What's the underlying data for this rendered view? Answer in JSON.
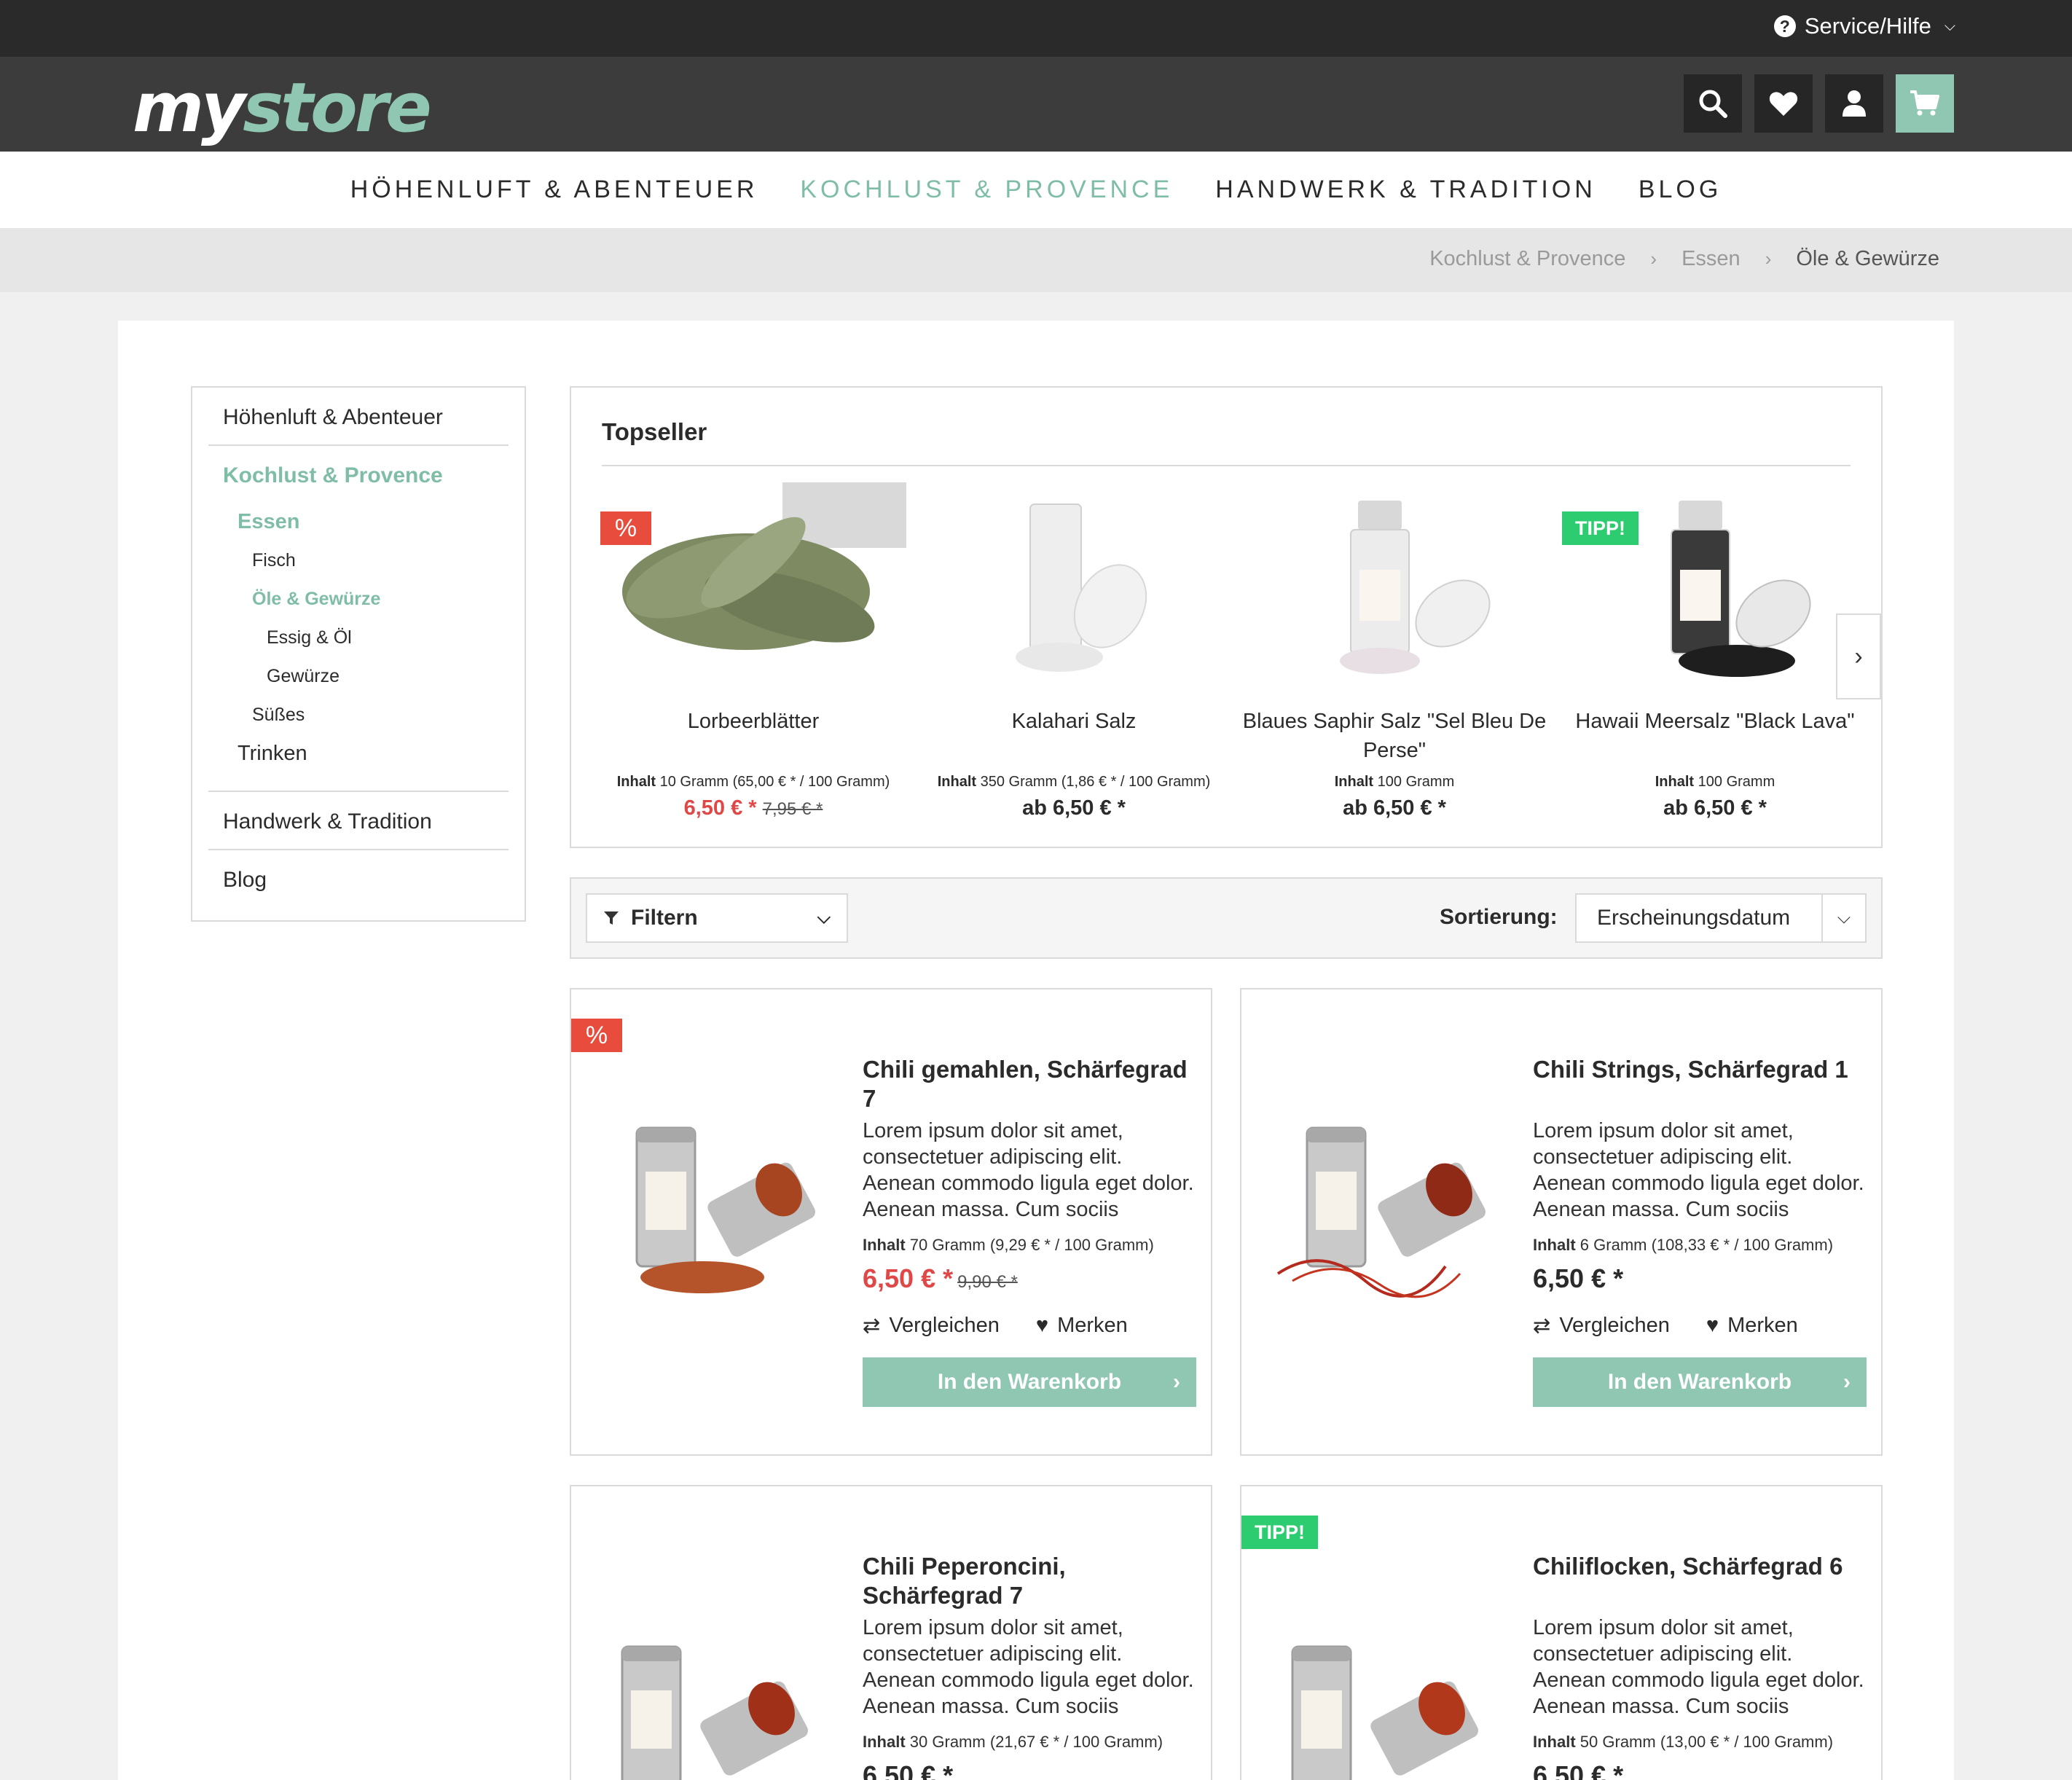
{
  "service": {
    "label": "Service/Hilfe"
  },
  "logo": {
    "part1": "my",
    "part2": "store"
  },
  "colors": {
    "accent": "#8fc7b3",
    "sale": "#e74c3c",
    "tipp": "#2ecc71",
    "header": "#3c3c3c",
    "topbar": "#2a2a2a"
  },
  "header_icons": [
    "search-icon",
    "heart-icon",
    "user-icon",
    "cart-icon"
  ],
  "mainnav": [
    "HÖHENLUFT & ABENTEUER",
    "KOCHLUST & PROVENCE",
    "HANDWERK & TRADITION",
    "BLOG"
  ],
  "breadcrumb": [
    "Kochlust & Provence",
    "Essen",
    "Öle & Gewürze"
  ],
  "sidebar": {
    "l1_a": "Höhenluft & Abenteuer",
    "l1_b": "Kochlust & Provence",
    "essen": "Essen",
    "fisch": "Fisch",
    "oele": "Öle & Gewürze",
    "essig": "Essig & Öl",
    "gewuerze": "Gewürze",
    "suesses": "Süßes",
    "trinken": "Trinken",
    "l1_c": "Handwerk & Tradition",
    "l1_d": "Blog"
  },
  "topseller": {
    "title": "Topseller",
    "items": [
      {
        "name": "Lorbeerblätter",
        "content_label": "Inhalt",
        "content": "10 Gramm (65,00 € * / 100 Gramm)",
        "price": "6,50 € *",
        "old_price": "7,95 € *",
        "badge": "%"
      },
      {
        "name": "Kalahari Salz",
        "content_label": "Inhalt",
        "content": "350 Gramm (1,86 € * / 100 Gramm)",
        "price": "ab 6,50 € *"
      },
      {
        "name": "Blaues Saphir Salz \"Sel Bleu De Perse\"",
        "content_label": "Inhalt",
        "content": "100 Gramm",
        "price": "ab 6,50 € *"
      },
      {
        "name": "Hawaii Meersalz \"Black Lava\"",
        "content_label": "Inhalt",
        "content": "100 Gramm",
        "price": "ab 6,50 € *",
        "badge": "TIPP!"
      }
    ]
  },
  "filter": {
    "label": "Filtern",
    "sort_label": "Sortierung:",
    "sort_value": "Erscheinungsdatum"
  },
  "products": [
    {
      "title": "Chili gemahlen, Schärfegrad 7",
      "desc": "Lorem ipsum dolor sit amet, consectetuer adipiscing elit. Aenean commodo ligula eget dolor. Aenean massa. Cum sociis",
      "content_label": "Inhalt",
      "content": "70 Gramm (9,29 € * / 100 Gramm)",
      "price": "6,50 € *",
      "old_price": "9,90 € *",
      "badge": "%",
      "compare": "Vergleichen",
      "remember": "Merken",
      "cart": "In den Warenkorb"
    },
    {
      "title": "Chili Strings, Schärfegrad 1",
      "desc": "Lorem ipsum dolor sit amet, consectetuer adipiscing elit. Aenean commodo ligula eget dolor. Aenean massa. Cum sociis",
      "content_label": "Inhalt",
      "content": "6 Gramm (108,33 € * / 100 Gramm)",
      "price": "6,50 € *",
      "compare": "Vergleichen",
      "remember": "Merken",
      "cart": "In den Warenkorb"
    },
    {
      "title": "Chili Peperoncini, Schärfegrad 7",
      "desc": "Lorem ipsum dolor sit amet, consectetuer adipiscing elit. Aenean commodo ligula eget dolor. Aenean massa. Cum sociis",
      "content_label": "Inhalt",
      "content": "30 Gramm (21,67 € * / 100 Gramm)",
      "price": "6,50 € *"
    },
    {
      "title": "Chiliflocken, Schärfegrad 6",
      "desc": "Lorem ipsum dolor sit amet, consectetuer adipiscing elit. Aenean commodo ligula eget dolor. Aenean massa. Cum sociis",
      "content_label": "Inhalt",
      "content": "50 Gramm (13,00 € * / 100 Gramm)",
      "price": "6,50 € *",
      "badge": "TIPP!"
    }
  ]
}
